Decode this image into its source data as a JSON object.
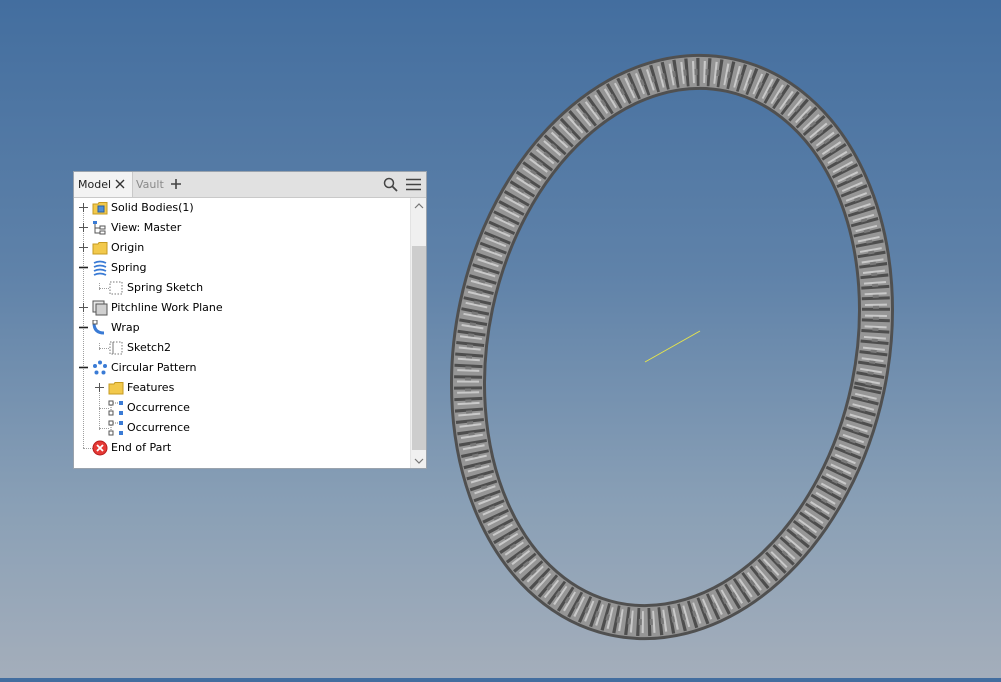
{
  "browser": {
    "tabs": {
      "model": "Model",
      "vault": "Vault"
    },
    "icons": {
      "close": "close-icon",
      "add": "plus-icon",
      "search": "search-icon",
      "menu": "hamburger-menu-icon"
    },
    "tree": [
      {
        "label": "Solid Bodies(1)",
        "icon": "solid-bodies-folder-icon"
      },
      {
        "label": "View: Master",
        "icon": "view-rep-icon"
      },
      {
        "label": "Origin",
        "icon": "folder-icon"
      },
      {
        "label": "Spring",
        "icon": "coil-feature-icon"
      },
      {
        "label": "Spring Sketch",
        "icon": "sketch-icon"
      },
      {
        "label": "Pitchline Work Plane",
        "icon": "work-plane-icon"
      },
      {
        "label": "Wrap",
        "icon": "wrap-feature-icon"
      },
      {
        "label": "Sketch2",
        "icon": "sketch-icon"
      },
      {
        "label": "Circular Pattern",
        "icon": "circular-pattern-icon"
      },
      {
        "label": "Features",
        "icon": "folder-icon"
      },
      {
        "label": "Occurrence",
        "icon": "occurrence-icon"
      },
      {
        "label": "Occurrence",
        "icon": "occurrence-icon"
      },
      {
        "label": "End of Part",
        "icon": "end-of-part-icon"
      }
    ]
  },
  "viewport": {
    "model": "coil-spring-ring",
    "axis_color": "#e8e64a"
  }
}
